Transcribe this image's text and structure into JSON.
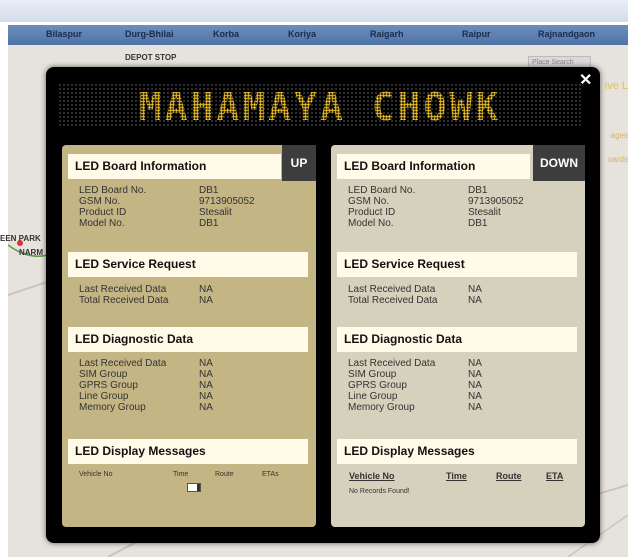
{
  "map": {
    "cities": [
      "Bilaspur",
      "Durg-Bhilai",
      "Korba",
      "Koriya",
      "Raigarh",
      "Raipur",
      "Rajnandgaon"
    ],
    "depot_label": "DEPOT STOP",
    "place_search": "Place Search",
    "left_labels": [
      "EEN PARK",
      "NARM"
    ],
    "right_peek": [
      "ive L",
      "ages",
      "oards"
    ]
  },
  "led_banner": "MAHAMAYA CHOWK",
  "close_glyph": "✕",
  "panels": [
    {
      "direction": "UP",
      "board_title": "LED Board Information",
      "board_rows": [
        {
          "label": "LED Board No.",
          "value": "DB1"
        },
        {
          "label": "GSM No.",
          "value": "9713905052"
        },
        {
          "label": "Product ID",
          "value": "Stesalit"
        },
        {
          "label": "Model No.",
          "value": "DB1"
        }
      ],
      "service_title": "LED Service Request",
      "service_rows": [
        {
          "label": "Last Received Data",
          "value": "NA"
        },
        {
          "label": "Total Received Data",
          "value": "NA"
        }
      ],
      "diag_title": "LED Diagnostic Data",
      "diag_rows": [
        {
          "label": "Last Received Data",
          "value": "NA"
        },
        {
          "label": "SIM Group",
          "value": "NA"
        },
        {
          "label": "GPRS Group",
          "value": "NA"
        },
        {
          "label": "Line Group",
          "value": "NA"
        },
        {
          "label": "Memory Group",
          "value": "NA"
        }
      ],
      "messages_title": "LED Display Messages",
      "messages_columns": [
        "Vehicle No",
        "Time",
        "Route",
        "ETAs"
      ]
    },
    {
      "direction": "DOWN",
      "board_title": "LED Board Information",
      "board_rows": [
        {
          "label": "LED Board No.",
          "value": "DB1"
        },
        {
          "label": "GSM No.",
          "value": "9713905052"
        },
        {
          "label": "Product ID",
          "value": "Stesalit"
        },
        {
          "label": "Model No.",
          "value": "DB1"
        }
      ],
      "service_title": "LED Service Request",
      "service_rows": [
        {
          "label": "Last Received Data",
          "value": "NA"
        },
        {
          "label": "Total Received Data",
          "value": "NA"
        }
      ],
      "diag_title": "LED Diagnostic Data",
      "diag_rows": [
        {
          "label": "Last Received Data",
          "value": "NA"
        },
        {
          "label": "SIM Group",
          "value": "NA"
        },
        {
          "label": "GPRS Group",
          "value": "NA"
        },
        {
          "label": "Line Group",
          "value": "NA"
        },
        {
          "label": "Memory Group",
          "value": "NA"
        }
      ],
      "messages_title": "LED Display Messages",
      "messages_columns": [
        "Vehicle No",
        "Time",
        "Route",
        "ETA"
      ],
      "no_records": "No Records Found!"
    }
  ]
}
